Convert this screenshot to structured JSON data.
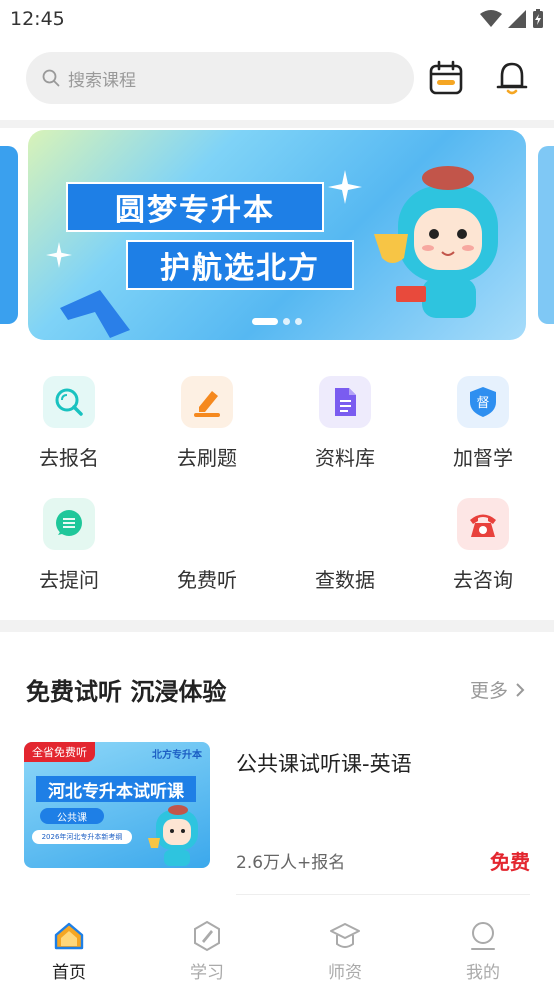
{
  "status": {
    "time": "12:45"
  },
  "search": {
    "placeholder": "搜索课程"
  },
  "banner": {
    "line1": "圆梦专升本",
    "line2": "护航选北方",
    "page_count": 3,
    "active_index": 0
  },
  "grid": [
    {
      "label": "去报名",
      "icon": "search-icon",
      "color": "#19c2c0"
    },
    {
      "label": "去刷题",
      "icon": "pencil-icon",
      "color": "#f5891f"
    },
    {
      "label": "资料库",
      "icon": "document-icon",
      "color": "#7a5cf0"
    },
    {
      "label": "加督学",
      "icon": "shield-icon",
      "color": "#2e8ff0",
      "glyph": "督"
    },
    {
      "label": "去提问",
      "icon": "chat-icon",
      "color": "#1fc79a"
    },
    {
      "label": "免费听",
      "icon": "",
      "color": ""
    },
    {
      "label": "查数据",
      "icon": "",
      "color": ""
    },
    {
      "label": "去咨询",
      "icon": "phone-icon",
      "color": "#e8413c"
    }
  ],
  "section": {
    "title": "免费试听 沉浸体验",
    "more": "更多"
  },
  "course": {
    "thumb": {
      "tag": "全省免费听",
      "brand": "北方专升本",
      "title": "河北专升本试听课",
      "chip": "公共课",
      "subtitle": "2026年河北专升本新考纲"
    },
    "title": "公共课试听课-英语",
    "count": "2.6万人+报名",
    "price": "免费"
  },
  "tabs": [
    {
      "label": "首页",
      "icon": "home-icon",
      "active": true
    },
    {
      "label": "学习",
      "icon": "study-icon",
      "active": false
    },
    {
      "label": "师资",
      "icon": "graduation-cap-icon",
      "active": false
    },
    {
      "label": "我的",
      "icon": "profile-icon",
      "active": false
    }
  ],
  "colors": {
    "accent": "#1e7fe6",
    "price": "#e3262f",
    "home_active": "#f5a623"
  }
}
